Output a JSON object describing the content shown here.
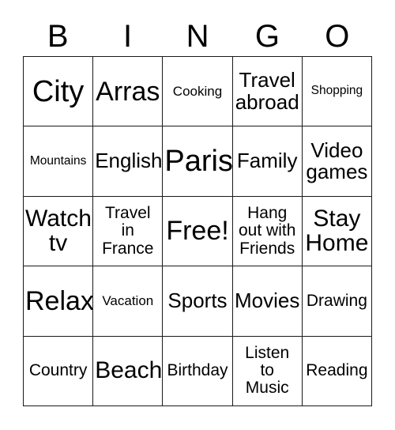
{
  "header": {
    "letters": [
      "B",
      "I",
      "N",
      "G",
      "O"
    ]
  },
  "grid": {
    "rows": [
      [
        {
          "text": "City",
          "size": "fs-xxl"
        },
        {
          "text": "Arras",
          "size": "fs-xl"
        },
        {
          "text": "Cooking",
          "size": "fs-xs"
        },
        {
          "text": "Travel\nabroad",
          "size": "fs-md"
        },
        {
          "text": "Shopping",
          "size": "fs-xxs"
        }
      ],
      [
        {
          "text": "Mountains",
          "size": "fs-xxs"
        },
        {
          "text": "English",
          "size": "fs-md"
        },
        {
          "text": "Paris",
          "size": "fs-xxl"
        },
        {
          "text": "Family",
          "size": "fs-md"
        },
        {
          "text": "Video\ngames",
          "size": "fs-md"
        }
      ],
      [
        {
          "text": "Watch\ntv",
          "size": "fs-lg"
        },
        {
          "text": "Travel\nin\nFrance",
          "size": "fs-sm"
        },
        {
          "text": "Free!",
          "size": "fs-xl"
        },
        {
          "text": "Hang\nout with\nFriends",
          "size": "fs-sm"
        },
        {
          "text": "Stay\nHome",
          "size": "fs-lg"
        }
      ],
      [
        {
          "text": "Relax",
          "size": "fs-xl"
        },
        {
          "text": "Vacation",
          "size": "fs-xs"
        },
        {
          "text": "Sports",
          "size": "fs-md"
        },
        {
          "text": "Movies",
          "size": "fs-md"
        },
        {
          "text": "Drawing",
          "size": "fs-sm"
        }
      ],
      [
        {
          "text": "Country",
          "size": "fs-sm"
        },
        {
          "text": "Beach",
          "size": "fs-lg"
        },
        {
          "text": "Birthday",
          "size": "fs-sm"
        },
        {
          "text": "Listen\nto\nMusic",
          "size": "fs-sm"
        },
        {
          "text": "Reading",
          "size": "fs-sm"
        }
      ]
    ]
  },
  "colors": {
    "border": "#1a1a1a",
    "text": "#000000",
    "background": "#ffffff"
  }
}
